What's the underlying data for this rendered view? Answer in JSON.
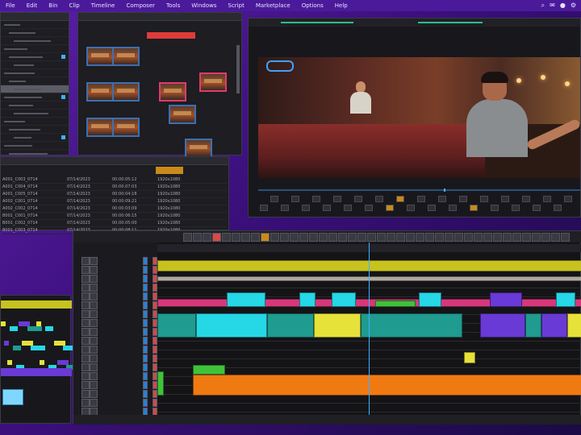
{
  "menubar": {
    "items": [
      "File",
      "Edit",
      "Bin",
      "Clip",
      "Timeline",
      "Composer",
      "Tools",
      "Windows",
      "Script",
      "Marketplace",
      "Options",
      "Help"
    ],
    "right_icons": [
      "search-icon",
      "message-icon",
      "user-icon",
      "settings-icon"
    ]
  },
  "media_list": {
    "rows": [
      {
        "name": "A001_C003_0714",
        "date": "07/14/2023",
        "dur": "00:00:05:12",
        "res": "1920x1080"
      },
      {
        "name": "A001_C004_0714",
        "date": "07/14/2023",
        "dur": "00:00:07:03",
        "res": "1920x1080"
      },
      {
        "name": "A001_C005_0714",
        "date": "07/14/2023",
        "dur": "00:00:04:18",
        "res": "1920x1080"
      },
      {
        "name": "A002_C001_0714",
        "date": "07/14/2023",
        "dur": "00:00:09:21",
        "res": "1920x1080"
      },
      {
        "name": "A002_C002_0714",
        "date": "07/14/2023",
        "dur": "00:00:03:09",
        "res": "1920x1080"
      },
      {
        "name": "B001_C001_0714",
        "date": "07/14/2023",
        "dur": "00:00:06:15",
        "res": "1920x1080"
      },
      {
        "name": "B001_C002_0714",
        "date": "07/14/2023",
        "dur": "00:00:05:00",
        "res": "1920x1080"
      },
      {
        "name": "B001_C003_0714",
        "date": "07/14/2023",
        "dur": "00:00:08:11",
        "res": "1920x1080"
      }
    ]
  },
  "colors": {
    "yellow": "#c7c21f",
    "cyan": "#26d7e6",
    "teal": "#1f9b8f",
    "pink": "#d6387a",
    "purple": "#6a3ad6",
    "orange": "#f07a12",
    "green": "#3fc23a",
    "lime": "#e6e23a"
  }
}
